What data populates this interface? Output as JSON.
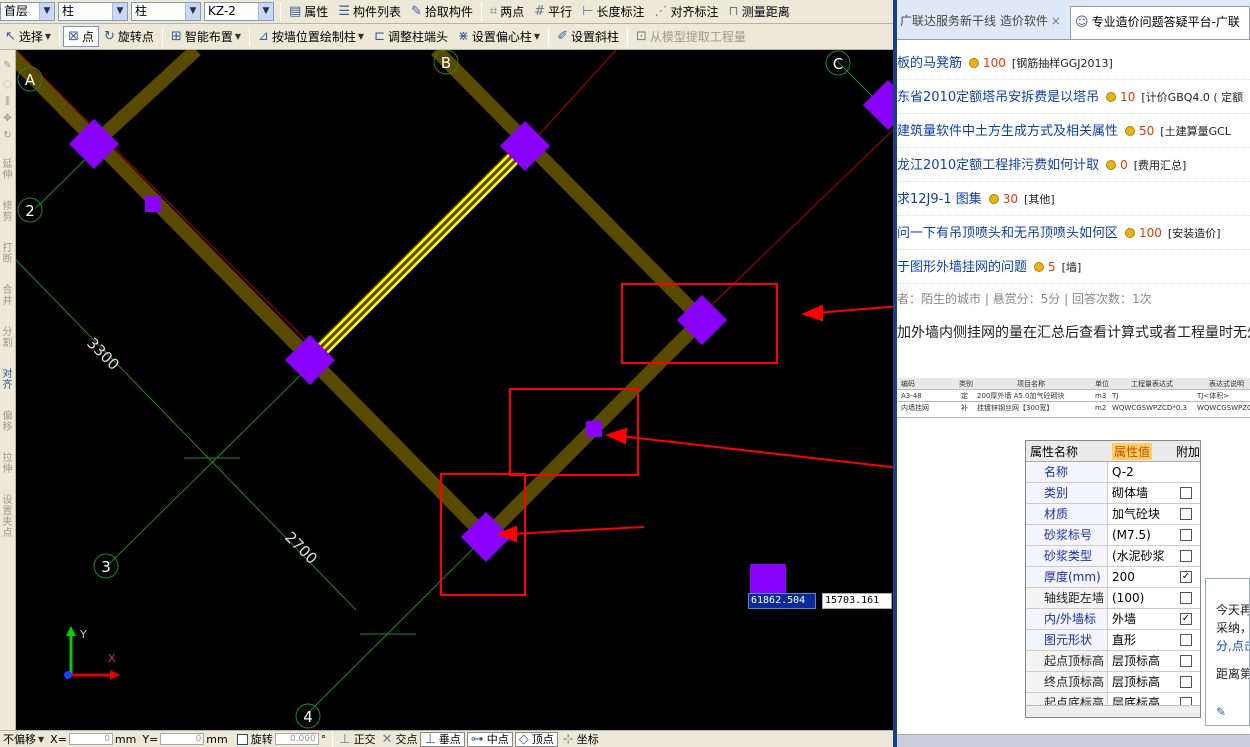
{
  "toolbar1": {
    "combo_floor": "首层",
    "combo_type1": "柱",
    "combo_type2": "柱",
    "combo_element": "KZ-2",
    "btn_property": "属性",
    "btn_component_list": "构件列表",
    "btn_pick_component": "拾取构件",
    "btn_two_points": "两点",
    "btn_parallel": "平行",
    "btn_length_dim": "长度标注",
    "btn_align_dim": "对齐标注",
    "btn_measure": "测量距离"
  },
  "toolbar2": {
    "btn_select": "选择",
    "btn_point": "点",
    "btn_rotate_point": "旋转点",
    "btn_smart_place": "智能布置",
    "btn_draw_by_wall": "按墙位置绘制柱",
    "btn_adjust_end": "调整柱端头",
    "btn_eccentric": "设置偏心柱",
    "btn_slant": "设置斜柱",
    "btn_extract": "从模型提取工程量"
  },
  "left_toolbar": [
    "延伸",
    "修剪",
    "打断",
    "合并",
    "分割",
    "对齐",
    "偏移",
    "拉伸",
    "设置夹点"
  ],
  "canvas": {
    "axis_labels": [
      "A",
      "B",
      "C",
      "2",
      "3",
      "4"
    ],
    "dim_labels": [
      "3300",
      "2700"
    ],
    "ucs_y": "Y",
    "ucs_x": "X",
    "coord_x": "61862.504",
    "coord_y": "15703.161",
    "colors": {
      "wall": "#5a4a00",
      "column": "#8a00ff",
      "beam": "#ffff00",
      "highlight": "#ff0000",
      "axis": "#00a000"
    }
  },
  "bottombar": {
    "no_offset": "不偏移",
    "x_label": "X=",
    "x_value": "0",
    "mm1": "mm",
    "y_label": "Y=",
    "y_value": "0",
    "mm2": "mm",
    "rotate": "旋转",
    "rotate_value": "0.000",
    "deg": "°",
    "ortho": "正交",
    "intersect": "交点",
    "perp": "垂点",
    "mid": "中点",
    "vertex": "顶点",
    "coord": "坐标"
  },
  "browser": {
    "tab1": "广联达服务新干线  造价软件",
    "tab2": "专业造价问题答疑平台-广联",
    "questions": [
      {
        "title": "板的马凳筋",
        "points": "100",
        "category": "[钢筋抽样GGJ2013]"
      },
      {
        "title": "东省2010定额塔吊安拆费是以塔吊",
        "points": "10",
        "category": "[计价GBQ4.0 ( 定额"
      },
      {
        "title": "建筑量软件中土方生成方式及相关属性",
        "points": "50",
        "category": "[土建算量GCL"
      },
      {
        "title": "龙江2010定额工程排污费如何计取",
        "points": "0",
        "category": "[费用汇总]"
      },
      {
        "title": "求12J9-1 图集",
        "points": "30",
        "category": "[其他]"
      },
      {
        "title": "问一下有吊顶喷头和无吊顶喷头如何区",
        "points": "100",
        "category": "[安装造价]"
      },
      {
        "title": "于图形外墙挂网的问题",
        "points": "5",
        "category": "[墙]"
      }
    ],
    "meta": "者：陌生的城市  |  悬赏分：5分  |  回答次数：1次",
    "question_text": "加外墙内侧挂网的量在汇总后查看计算式或者工程量时无外",
    "mini_table": {
      "header": [
        "编码",
        "类别",
        "项目名称",
        "单位",
        "工程量表达式",
        "表达式说明"
      ],
      "rows": [
        [
          "A3-48",
          "定",
          "200厚外墙 A5.0加气砼砌块",
          "m3",
          "TJ",
          "TJ<体积>"
        ],
        [
          "内墙挂网",
          "补",
          "挂镀锌钢丝网【300宽】",
          "m2",
          "WQWCGSWPZCD*0.3",
          "WQWCGSWPZCD<外墙外侧钢丝网片总长度>*0.3"
        ]
      ]
    },
    "prop_table": {
      "col_name": "属性名称",
      "col_value": "属性值",
      "col_extra": "附加",
      "rows": [
        {
          "name": "名称",
          "value": "Q-2",
          "checked": null
        },
        {
          "name": "类别",
          "value": "砌体墙",
          "checked": false
        },
        {
          "name": "材质",
          "value": "加气砼块",
          "checked": false
        },
        {
          "name": "砂浆标号",
          "value": "(M7.5)",
          "checked": false
        },
        {
          "name": "砂浆类型",
          "value": "(水泥砂浆",
          "checked": false
        },
        {
          "name": "厚度(mm)",
          "value": "200",
          "checked": true
        },
        {
          "name": "轴线距左墙",
          "value": "(100)",
          "checked": false
        },
        {
          "name": "内/外墙标",
          "value": "外墙",
          "checked": true
        },
        {
          "name": "图元形状",
          "value": "直形",
          "checked": false
        },
        {
          "name": "起点顶标高",
          "value": "层顶标高",
          "checked": false
        },
        {
          "name": "终点顶标高",
          "value": "层顶标高",
          "checked": false
        },
        {
          "name": "起点底标高",
          "value": "层底标高",
          "checked": false
        }
      ]
    },
    "popup_lines": [
      "今天再",
      "采纳，",
      "分,点击",
      "距离第"
    ]
  }
}
